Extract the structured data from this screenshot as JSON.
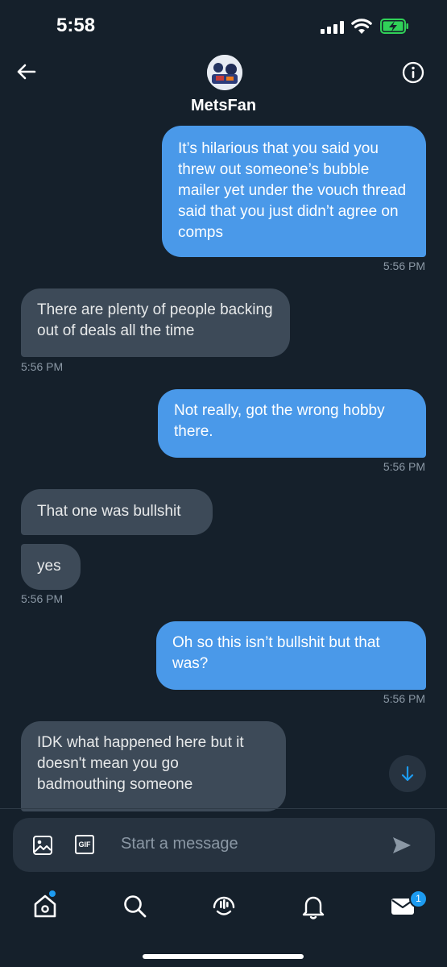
{
  "status_bar": {
    "time": "5:58"
  },
  "header": {
    "contact_name": "MetsFan"
  },
  "messages": [
    {
      "direction": "sent",
      "text": "It’s hilarious that you said you threw out someone’s bubble mailer yet under the vouch thread said that you just didn’t agree on comps",
      "time": "5:56 PM"
    },
    {
      "direction": "received",
      "text": "There are plenty of people backing out of deals all the time",
      "time": "5:56 PM"
    },
    {
      "direction": "sent",
      "text": "Not really, got the wrong hobby there.",
      "time": "5:56 PM"
    },
    {
      "direction": "received",
      "text": "That one was bullshit"
    },
    {
      "direction": "received",
      "text": "yes",
      "time": "5:56 PM"
    },
    {
      "direction": "sent",
      "text": "Oh so this isn’t bullshit but that was?",
      "time": "5:56 PM"
    },
    {
      "direction": "received",
      "text": "IDK what happened here but it doesn't mean you go badmouthing someone"
    }
  ],
  "composer": {
    "placeholder": "Start a message",
    "gif_label": "GIF"
  },
  "tab_bar": {
    "messages_badge": "1"
  }
}
